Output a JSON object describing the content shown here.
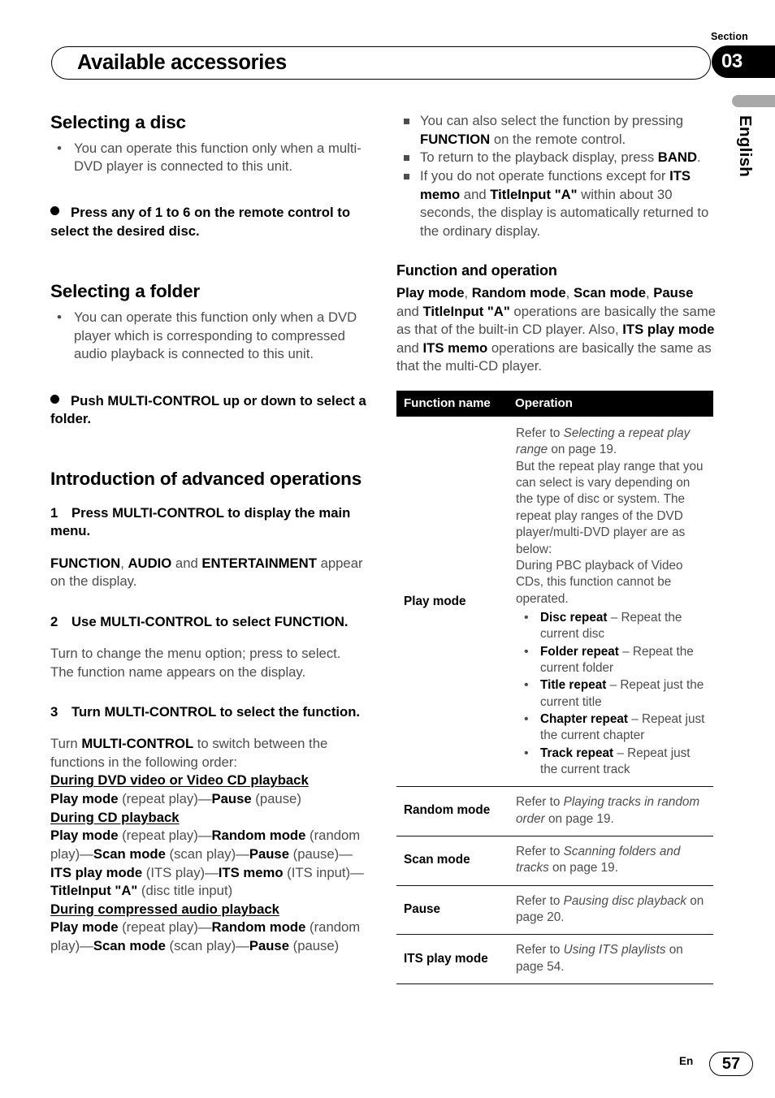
{
  "header": {
    "section_label": "Section",
    "section_number": "03",
    "title": "Available accessories"
  },
  "sidebar": {
    "language": "English"
  },
  "footer": {
    "lang_code": "En",
    "page_number": "57"
  },
  "left_column": {
    "selecting_disc": {
      "heading": "Selecting a disc",
      "bullet": "You can operate this function only when a multi-DVD player is connected to this unit.",
      "action": "Press any of 1 to 6 on the remote control to select the desired disc."
    },
    "selecting_folder": {
      "heading": "Selecting a folder",
      "bullet": "You can operate this function only when a DVD player which is corresponding to compressed audio playback is connected to this unit.",
      "action": "Push MULTI-CONTROL up or down to select a folder."
    },
    "intro_advanced": {
      "heading": "Introduction of advanced operations",
      "step1": {
        "num": "1",
        "title": "Press MULTI-CONTROL to display the main menu.",
        "body_html": "<b>FUNCTION</b>, <b>AUDIO</b> and <b>ENTERTAINMENT</b> appear on the display."
      },
      "step2": {
        "num": "2",
        "title": "Use MULTI-CONTROL to select FUNCTION.",
        "body1": "Turn to change the menu option; press to select.",
        "body2": "The function name appears on the display."
      },
      "step3": {
        "num": "3",
        "title": "Turn MULTI-CONTROL to select the function.",
        "body_html": "Turn <b>MULTI-CONTROL</b> to switch between the functions in the following order:"
      },
      "order_lists": [
        {
          "heading": "During DVD video or Video CD playback",
          "sequence_html": "<b>Play mode</b> (repeat play)—<b>Pause</b> (pause)"
        },
        {
          "heading": "During CD playback",
          "sequence_html": "<b>Play mode</b> (repeat play)—<b>Random mode</b> (random play)—<b>Scan mode</b> (scan play)—<b>Pause</b> (pause)—<b>ITS play mode</b> (ITS play)—<b>ITS memo</b> (ITS input)—<b>TitleInput \"A\"</b> (disc title input)"
        },
        {
          "heading": "During compressed audio playback",
          "sequence_html": "<b>Play mode</b> (repeat play)—<b>Random mode</b> (random play)—<b>Scan mode</b> (scan play)—<b>Pause</b> (pause)"
        }
      ]
    }
  },
  "right_column": {
    "notes": [
      "You can also select the function by pressing <b>FUNCTION</b> on the remote control.",
      "To return to the playback display, press <b>BAND</b>.",
      "If you do not operate functions except for <b>ITS memo</b> and <b>TitleInput \"A\"</b> within about 30 seconds, the display is automatically returned to the ordinary display."
    ],
    "function_and_operation": {
      "heading": "Function and operation",
      "body_html": "<b>Play mode</b>, <b>Random mode</b>, <b>Scan mode</b>, <b>Pause</b> and <b>TitleInput \"A\"</b> operations are basically the same as that of the built-in CD player. Also, <b>ITS play mode</b> and <b>ITS memo</b> operations are basically the same as that the multi-CD player."
    },
    "table": {
      "columns": [
        "Function name",
        "Operation"
      ],
      "rows": [
        {
          "name": "Play mode",
          "operation_html": "Refer to <i>Selecting a repeat play range</i> on page 19.<br>But the repeat play range that you can select is vary depending on the type of disc or system. The repeat play ranges of the DVD player/multi-DVD player are as below:<br>During PBC playback of Video CDs, this function cannot be operated.",
          "bullets": [
            "<b>Disc repeat</b> – Repeat the current disc",
            "<b>Folder repeat</b> – Repeat the current folder",
            "<b>Title repeat</b> – Repeat just the current title",
            "<b>Chapter repeat</b> – Repeat just the current chapter",
            "<b>Track repeat</b> – Repeat just the current track"
          ]
        },
        {
          "name": "Random mode",
          "operation_html": "Refer to <i>Playing tracks in random order</i> on page 19.",
          "bullets": []
        },
        {
          "name": "Scan mode",
          "operation_html": "Refer to <i>Scanning folders and tracks</i> on page 19.",
          "bullets": []
        },
        {
          "name": "Pause",
          "operation_html": "Refer to <i>Pausing disc playback</i> on page 20.",
          "bullets": []
        },
        {
          "name": "ITS play mode",
          "operation_html": "Refer to <i>Using ITS playlists</i> on page 54.",
          "bullets": []
        }
      ]
    }
  }
}
